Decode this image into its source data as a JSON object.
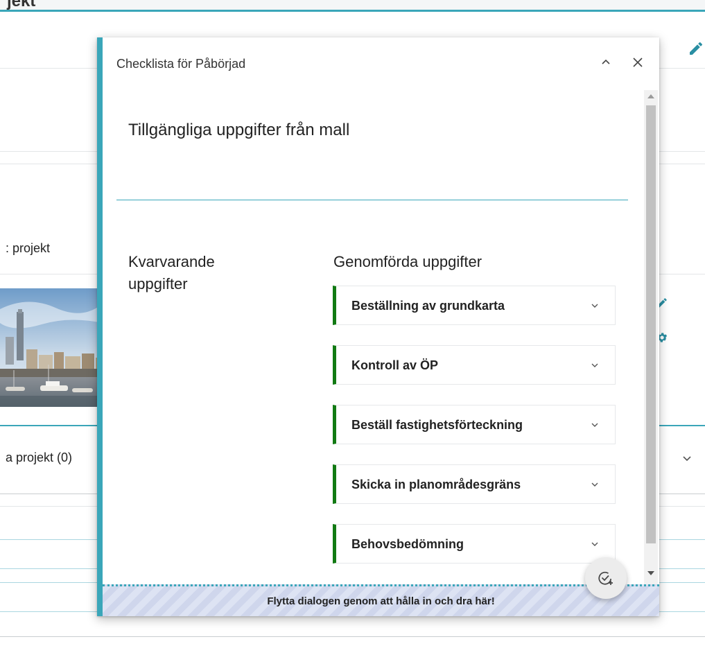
{
  "background": {
    "title_fragment": "jekt",
    "projects_label": ": projekt",
    "related_projects_label": "a projekt (0)"
  },
  "dialog": {
    "title": "Checklista för Påbörjad",
    "available_heading": "Tillgängliga uppgifter från mall",
    "remaining_heading": "Kvarvarande uppgifter",
    "completed_heading": "Genomförda uppgifter",
    "completed_tasks": [
      {
        "label": "Beställning av grundkarta"
      },
      {
        "label": "Kontroll av ÖP"
      },
      {
        "label": "Beställ fastighetsförteckning"
      },
      {
        "label": "Skicka in planområdesgräns"
      },
      {
        "label": "Behovsbedömning"
      }
    ],
    "drag_hint": "Flytta dialogen genom att hålla in och dra här!"
  },
  "icons": {
    "collapse": "chevron-up-icon",
    "close": "close-icon",
    "task_expand": "chevron-down-icon",
    "add_task": "add-check-icon",
    "edit": "pencil-icon",
    "settings": "gear-icon"
  },
  "colors": {
    "accent": "#3aa6b9",
    "task_border": "#127a13",
    "edit_icon": "#2a8fa3"
  }
}
